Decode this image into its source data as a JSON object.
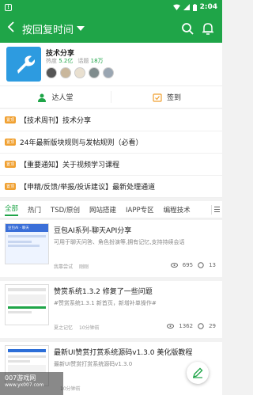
{
  "status_bar": {
    "time": "2:04",
    "icons": [
      "notification-icon",
      "wifi-icon",
      "signal-icon",
      "battery-icon"
    ]
  },
  "app_bar": {
    "sort_label": "按回复时间",
    "icons": [
      "back-arrow-icon",
      "chevron-down-icon",
      "search-icon",
      "bell-icon"
    ]
  },
  "forum": {
    "name": "技术分享",
    "heat_label": "热度",
    "heat_value": "5.2亿",
    "topics_label": "话题",
    "topics_value": "18万",
    "logo_icon": "wrench-icon"
  },
  "actions": {
    "hall_label": "达人堂",
    "checkin_label": "签到"
  },
  "pinned": {
    "tag": "置顶",
    "items": [
      "【技术周刊】技术分享",
      "24年最新版块规则与发帖规则（必看）",
      "【重要通知】关于视频学习课程",
      "【申精/反馈/举报/投诉建议】最新处理通道"
    ]
  },
  "tabs": [
    "全部",
    "热门",
    "TSD/原创",
    "网站搭建",
    "IAPP专区",
    "编程技术"
  ],
  "posts": [
    {
      "title": "豆包AI系列-聊天API分享",
      "desc": "可用于聊天问答、角色扮演等,拥有记忆,支持持续会话",
      "author": "我靠尝试",
      "time": "刚刚",
      "views": "695",
      "comments": "13",
      "thumb_caption": "豆包AI - 聊天"
    },
    {
      "title": "赞赏系统1.3.2 修复了一些问题",
      "desc": "#赞赏系统1.3.1 新首页，新增补单操作#",
      "author": "夏之记忆",
      "time": "10分钟前",
      "views": "1362",
      "comments": "29",
      "thumb_caption": ""
    },
    {
      "title": "最新UI赞赏打赏系统源码v1.3.0 美化版教程",
      "desc": "最新UI赞赏打赏系统源码v1.3.0",
      "author": "",
      "time": "10分钟前",
      "views": "",
      "comments": "",
      "thumb_caption": ""
    }
  ],
  "watermark": {
    "line1": "007游戏网",
    "line2": "www.yx007.com"
  },
  "fab_icon": "edit-pen-icon",
  "colors": {
    "primary": "#1fa548",
    "pinned_tag": "#f0a030",
    "logo_bg": "#2d9be0"
  }
}
